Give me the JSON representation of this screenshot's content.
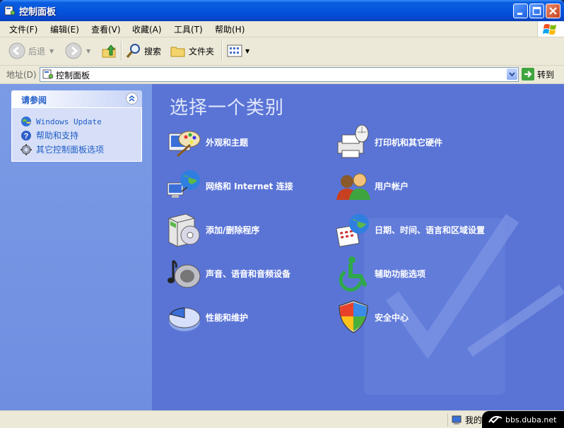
{
  "window": {
    "title": "控制面板"
  },
  "menu": [
    "文件(F)",
    "编辑(E)",
    "查看(V)",
    "收藏(A)",
    "工具(T)",
    "帮助(H)"
  ],
  "toolbar": {
    "back": "后退",
    "search": "搜索",
    "folders": "文件夹"
  },
  "address": {
    "label": "地址(D)",
    "value": "控制面板",
    "go": "转到"
  },
  "sidebar": {
    "panel_title": "请参阅",
    "links": [
      "Windows Update",
      "帮助和支持",
      "其它控制面板选项"
    ]
  },
  "main": {
    "heading": "选择一个类别",
    "categories": [
      "外观和主题",
      "打印机和其它硬件",
      "网络和 Internet 连接",
      "用户帐户",
      "添加/删除程序",
      "日期、时间、语言和区域设置",
      "声音、语音和音频设备",
      "辅助功能选项",
      "性能和维护",
      "安全中心"
    ]
  },
  "status": {
    "zone": "我的电脑",
    "watermark": "bbs.duba.net"
  }
}
